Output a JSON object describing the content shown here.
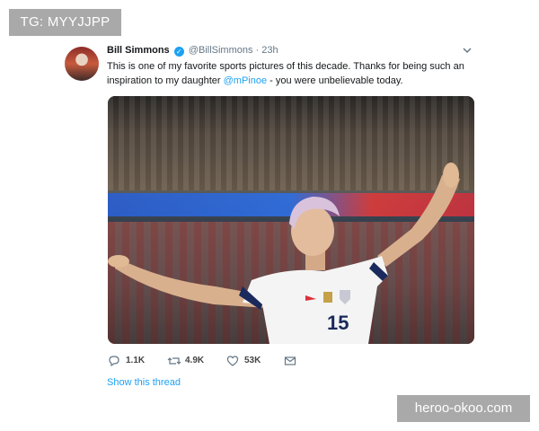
{
  "watermarks": {
    "top_left": "TG: MYYJJPP",
    "bottom_right": "heroo-okoo.com"
  },
  "tweet": {
    "author_name": "Bill Simmons",
    "verified_icon": "verified-badge-icon",
    "handle": "@BillSimmons",
    "separator": "·",
    "time": "23h",
    "text_before_mention": "This is one of my favorite sports pictures of this decade. Thanks for being such an inspiration to my daughter ",
    "mention": "@mPinoe",
    "text_after_mention": " - you were unbelievable today.",
    "jersey_number": "15",
    "actions": {
      "reply_count": "1.1K",
      "retweet_count": "4.9K",
      "like_count": "53K"
    },
    "show_thread": "Show this thread"
  },
  "colors": {
    "accent": "#1da1f2",
    "muted": "#657786",
    "watermark_bg": "#a9a9a9"
  }
}
